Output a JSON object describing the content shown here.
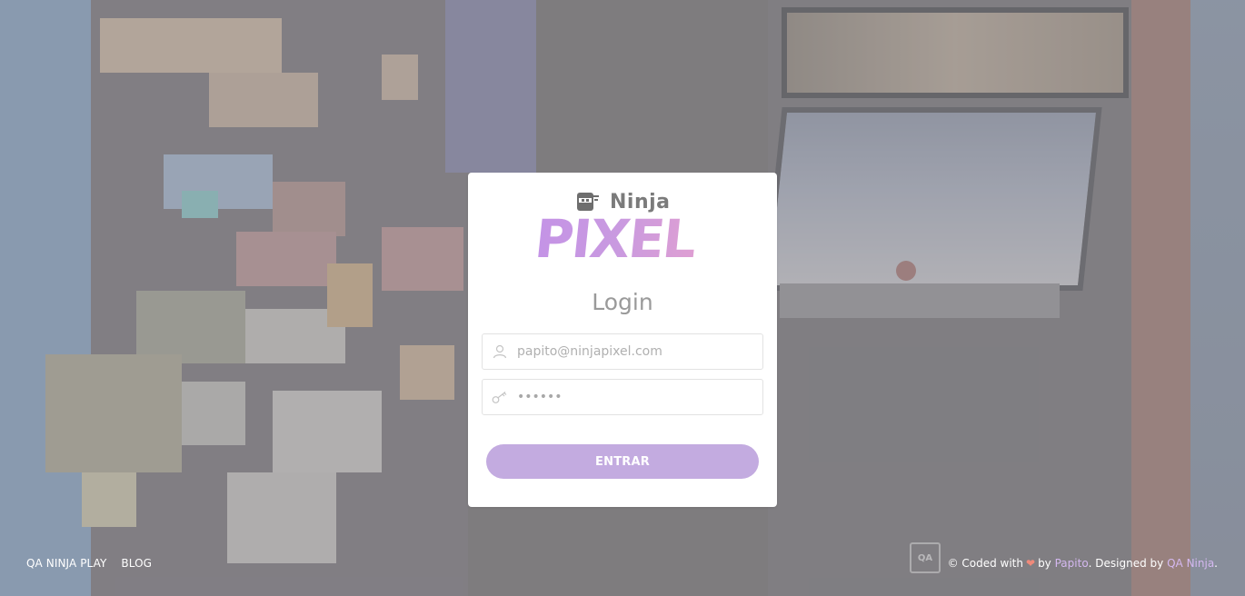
{
  "logo": {
    "top_text": "Ninja",
    "main_text": "PIXEL"
  },
  "login": {
    "title": "Login",
    "email": {
      "placeholder": "papito@ninjapixel.com",
      "icon": "user-icon"
    },
    "password": {
      "value": "pwd123",
      "icon": "key-icon"
    },
    "submit_label": "ENTRAR",
    "accent_color": "#c3abe0"
  },
  "footer": {
    "nav": [
      {
        "label": "QA NINJA PLAY"
      },
      {
        "label": "BLOG"
      }
    ],
    "badge_text": "QA",
    "credit": {
      "prefix": "© Coded with",
      "heart": "❤",
      "by": "by",
      "author": "Papito",
      "designed_by": ". Designed by",
      "designer": "QA Ninja",
      "suffix": "."
    },
    "link_color": "#d4b8f0"
  }
}
